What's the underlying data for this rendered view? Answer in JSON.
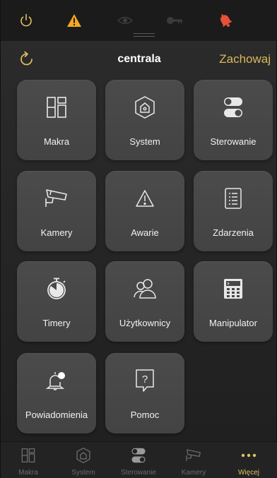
{
  "colors": {
    "accent": "#e2c15f",
    "warning": "#f5a623",
    "bell": "#e8503a",
    "tile": "#474747"
  },
  "header": {
    "title": "centrala",
    "save_label": "Zachowaj"
  },
  "tiles": [
    {
      "label": "Makra",
      "icon": "macros-icon"
    },
    {
      "label": "System",
      "icon": "system-house-icon"
    },
    {
      "label": "Sterowanie",
      "icon": "toggle-switches-icon"
    },
    {
      "label": "Kamery",
      "icon": "camera-icon"
    },
    {
      "label": "Awarie",
      "icon": "warning-triangle-icon"
    },
    {
      "label": "Zdarzenia",
      "icon": "event-list-icon"
    },
    {
      "label": "Timery",
      "icon": "stopwatch-icon"
    },
    {
      "label": "Użytkownicy",
      "icon": "users-icon"
    },
    {
      "label": "Manipulator",
      "icon": "keypad-icon"
    },
    {
      "label": "Powiadomienia",
      "icon": "notification-bell-icon"
    },
    {
      "label": "Pomoc",
      "icon": "help-icon"
    }
  ],
  "bottom_nav": [
    {
      "label": "Makra",
      "icon": "macros-icon",
      "active": false
    },
    {
      "label": "System",
      "icon": "system-house-icon",
      "active": false
    },
    {
      "label": "Sterowanie",
      "icon": "toggle-switches-icon",
      "active": false
    },
    {
      "label": "Kamery",
      "icon": "camera-icon",
      "active": false
    },
    {
      "label": "Więcej",
      "icon": "more-dots-icon",
      "active": true
    }
  ]
}
